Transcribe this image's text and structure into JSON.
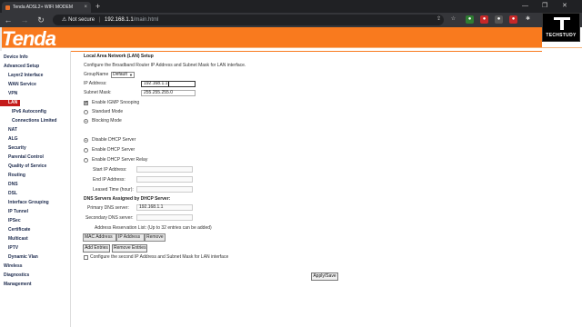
{
  "browser": {
    "tab_title": "Tenda ADSL2+ WIFI MODEM",
    "tab_close": "×",
    "new_tab": "+",
    "url_warning": "Not secure",
    "url_host": "192.168.1.1",
    "url_path": "/main.html"
  },
  "overlay": {
    "brand": "TECHSTUDY"
  },
  "header": {
    "logo": "Tenda"
  },
  "sidebar": {
    "items": [
      {
        "label": "Device Info",
        "level": 0
      },
      {
        "label": "Advanced Setup",
        "level": 0
      },
      {
        "label": "Layer2 Interface",
        "level": 1
      },
      {
        "label": "WAN Service",
        "level": 1
      },
      {
        "label": "VPN",
        "level": 1
      },
      {
        "label": "LAN",
        "level": 1
      },
      {
        "label": "IPv6 Autoconfig",
        "level": 2
      },
      {
        "label": "Connections Limited",
        "level": 2
      },
      {
        "label": "NAT",
        "level": 1
      },
      {
        "label": "ALG",
        "level": 1
      },
      {
        "label": "Security",
        "level": 1
      },
      {
        "label": "Parental Control",
        "level": 1
      },
      {
        "label": "Quality of Service",
        "level": 1
      },
      {
        "label": "Routing",
        "level": 1
      },
      {
        "label": "DNS",
        "level": 1
      },
      {
        "label": "DSL",
        "level": 1
      },
      {
        "label": "Interface Grouping",
        "level": 1
      },
      {
        "label": "IP Tunnel",
        "level": 1
      },
      {
        "label": "IPSec",
        "level": 1
      },
      {
        "label": "Certificate",
        "level": 1
      },
      {
        "label": "Multicast",
        "level": 1
      },
      {
        "label": "IPTV",
        "level": 1
      },
      {
        "label": "Dynamic Vlan",
        "level": 1
      },
      {
        "label": "Wireless",
        "level": 0
      },
      {
        "label": "Diagnostics",
        "level": 0
      },
      {
        "label": "Management",
        "level": 0
      }
    ]
  },
  "main": {
    "title": "Local Area Network (LAN) Setup",
    "description": "Configure the Broadband Router IP Address and Subnet Mask for LAN interface.",
    "group_name_label": "GroupName",
    "group_name_value": "Default",
    "ip_label": "IP Address:",
    "ip_value": "192.168.1.1",
    "subnet_label": "Subnet Mask:",
    "subnet_value": "255.255.255.0",
    "igmp_label": "Enable IGMP Snooping",
    "standard_mode": "Standard Mode",
    "blocking_mode": "Blocking Mode",
    "disable_dhcp": "Disable DHCP Server",
    "enable_dhcp": "Enable DHCP Server",
    "enable_dhcp_relay": "Enable DHCP Server Relay",
    "start_ip_label": "Start IP Address:",
    "end_ip_label": "End IP Address:",
    "leased_time_label": "Leased Time (hour):",
    "dns_heading": "DNS Servers Assigned by DHCP Server:",
    "primary_dns_label": "Primary DNS server:",
    "primary_dns_value": "192.168.1.1",
    "secondary_dns_label": "Secondary DNS server:",
    "reservation_note": "Address Reservation List: (Up to 32 entries can be added)",
    "table_headers": [
      "MAC Address",
      "IP Address",
      "Remove"
    ],
    "add_entries": "Add Entries",
    "remove_entries": "Remove Entries",
    "second_ip_label": "Configure the second IP Address and Subnet Mask for LAN interface",
    "apply_save": "Apply/Save"
  }
}
